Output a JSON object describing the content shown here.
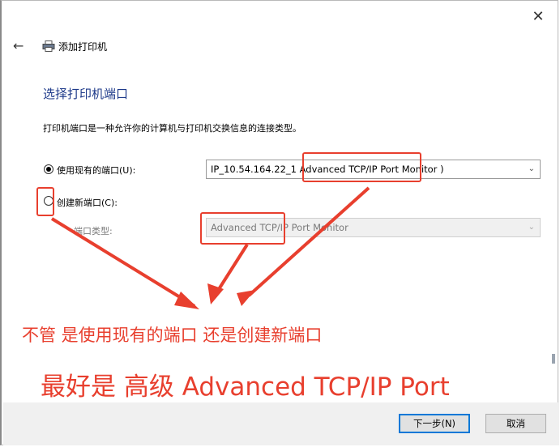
{
  "window": {
    "close_glyph": "✕",
    "back_glyph": "←",
    "title": "添加打印机"
  },
  "main": {
    "heading": "选择打印机端口",
    "description": "打印机端口是一种允许你的计算机与打印机交换信息的连接类型。"
  },
  "options": {
    "use_existing": {
      "label": "使用现有的端口(U):",
      "selected": true
    },
    "existing_port_value": "IP_10.54.164.22_1  Advanced TCP/IP Port Monitor )",
    "create_new": {
      "label": "创建新端口(C):",
      "selected": false
    },
    "port_type_label": "端口类型:",
    "port_type_value": "Advanced TCP/IP Port Monitor"
  },
  "annotations": {
    "note_line1": "不管 是使用现有的端口 还是创建新端口",
    "note_line2": "最好是 高级 Advanced TCP/IP Port",
    "color": "#e83f2e"
  },
  "footer": {
    "next_label": "下一步(N)",
    "cancel_label": "取消"
  },
  "icons": {
    "dropdown": "⌄"
  }
}
